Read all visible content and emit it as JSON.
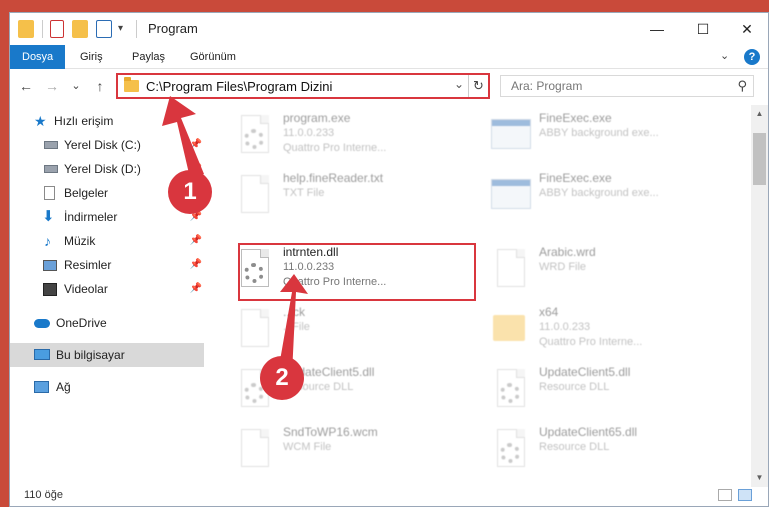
{
  "window": {
    "title": "Program",
    "controls": {
      "minimize": "—",
      "maximize": "☐",
      "close": "✕"
    }
  },
  "ribbon": {
    "tabs": [
      {
        "label": "Dosya",
        "active": true
      },
      {
        "label": "Giriş"
      },
      {
        "label": "Paylaş"
      },
      {
        "label": "Görünüm"
      }
    ],
    "expand": "⌄",
    "help": "?"
  },
  "nav": {
    "back": "←",
    "forward": "→",
    "recent": "⌄",
    "up": "↑",
    "address": "C:\\Program Files\\Program Dizini",
    "address_dropdown": "⌄",
    "refresh": "↻",
    "search_placeholder": "Ara: Program",
    "search_icon": "⚲"
  },
  "sidebar": {
    "items": [
      {
        "label": "Hızlı erişim",
        "icon": "star-icon"
      },
      {
        "label": "Yerel Disk (C:)",
        "icon": "drive-icon",
        "pin": "📌"
      },
      {
        "label": "Yerel Disk (D:)",
        "icon": "drive-icon",
        "pin": "📌"
      },
      {
        "label": "Belgeler",
        "icon": "documents-icon",
        "pin": "📌"
      },
      {
        "label": "İndirmeler",
        "icon": "download-icon",
        "pin": "📌"
      },
      {
        "label": "Müzik",
        "icon": "music-icon",
        "pin": "📌"
      },
      {
        "label": "Resimler",
        "icon": "pictures-icon",
        "pin": "📌"
      },
      {
        "label": "Videolar",
        "icon": "video-icon",
        "pin": "📌"
      },
      {
        "label": "OneDrive",
        "icon": "cloud-icon"
      },
      {
        "label": "Bu bilgisayar",
        "icon": "computer-icon",
        "selected": true
      },
      {
        "label": "Ağ",
        "icon": "network-icon"
      }
    ]
  },
  "files": [
    {
      "name": "program.exe",
      "line2": "11.0.0.233",
      "line3": "Quattro Pro Interne...",
      "type": "exe"
    },
    {
      "name": "FineExec.exe",
      "line2": "ABBY background exe...",
      "type": "exe"
    },
    {
      "name": "help.fineReader.txt",
      "line2": "TXT File",
      "type": "doc"
    },
    {
      "name": "FineExec.exe",
      "line2": "ABBY background exe...",
      "type": "exe"
    },
    {
      "name": "intrnten.dll",
      "line2": "11.0.0.233",
      "line3": "Quattro Pro Interne...",
      "type": "dll",
      "highlight": true
    },
    {
      "name": "Arabic.wrd",
      "line2": "WRD File",
      "type": "doc"
    },
    {
      "name": "...ck",
      "line2": "...File",
      "type": "doc"
    },
    {
      "name": "x64",
      "line2": "11.0.0.233",
      "line3": "Quattro Pro Interne...",
      "type": "folder"
    },
    {
      "name": "UpdateClient5.dll",
      "line2": "Resource DLL",
      "type": "dll"
    },
    {
      "name": "UpdateClient5.dll",
      "line2": "Resource DLL",
      "type": "dll"
    },
    {
      "name": "SndToWP16.wcm",
      "line2": "WCM File",
      "type": "doc"
    },
    {
      "name": "UpdateClient65.dll",
      "line2": "Resource DLL",
      "type": "dll"
    }
  ],
  "status": {
    "count": "110 öğe"
  },
  "annotations": {
    "step1": "1",
    "step2": "2"
  },
  "colors": {
    "accent": "#1979ca",
    "highlight": "#d9363e"
  }
}
